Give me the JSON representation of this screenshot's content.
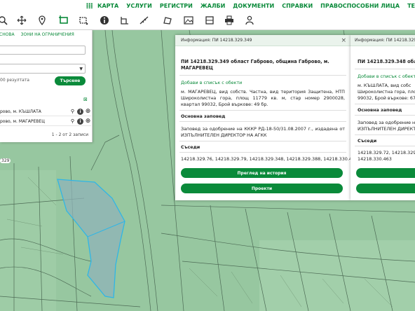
{
  "topnav": {
    "items": [
      "КАРТА",
      "УСЛУГИ",
      "РЕГИСТРИ",
      "ЖАЛБИ",
      "ДОКУМЕНТИ",
      "СПРАВКИ",
      "ПРАВОСПОСОБНИ ЛИЦА",
      "ТЕ"
    ]
  },
  "toolbar": {
    "icons": [
      "zoom-icon",
      "pan-icon",
      "location-pin-icon",
      "select-rectangle-icon",
      "select-polygon-icon",
      "info-icon",
      "measure-angle-icon",
      "measure-distance-icon",
      "area-icon",
      "image-icon",
      "layers-icon",
      "print-icon",
      "user-icon"
    ]
  },
  "left_panel": {
    "tab_a": "СНОВА",
    "tab_b": "ЗОНИ НА ОГРАНИЧЕНИЯ",
    "results": "00 резултата",
    "search_button": "Търсене",
    "rows": [
      "рово, м. КЪШЛАТА",
      "рово, м. МАГАРЕВЕЦ"
    ],
    "pager": "1 - 2 от 2 записи"
  },
  "popup1": {
    "header": "Информация: ПИ 14218.329.349",
    "title": "ПИ 14218.329.349 област Габрово, община Габрово, м. МАГАРЕВЕЦ",
    "add_link": "Добави в списък с обекти",
    "description": "м. МАГАРЕВЕЦ, вид собств. Частна, вид територия Защитена, НТП Широколистна гора, площ 11779 кв. м, стар номер 2900028, квартал 99032, Брой въркове: 49 бр.",
    "order_heading": "Основна заповед",
    "order_text": "Заповед за одобрение на КККР РД-18-50/31.08.2007 г., издадена от ИЗПЪЛНИТЕЛЕН ДИРЕКТОР НА АГКК",
    "neighbors_heading": "Съседи",
    "neighbors_text": "14218.329.76, 14218.329.79, 14218.329.348, 14218.329.388, 14218.330.463",
    "history_button": "Преглед на история",
    "projects_button": "Проекти"
  },
  "popup2": {
    "header": "Информация: ПИ 14218.329.34",
    "title": "ПИ 14218.329.348 облас",
    "add_link": "Добави в списък с обекти",
    "description_l1": "м. КЪШЛАТА, вид собс",
    "description_l2": "Широколистна гора, площ",
    "description_l3": "99032, Брой въркове: 67 б",
    "order_heading": "Основна заповед",
    "order_l1": "Заповед за одобрение н",
    "order_l2": "ИЗПЪЛНИТЕЛЕН ДИРЕКТО",
    "neighbors_heading": "Съседи",
    "neighbors_l1": "14218.329.72, 14218.329.7",
    "neighbors_l2": "14218.330.463"
  },
  "map_labels": {
    "label_329": "329"
  },
  "colors": {
    "brand_green": "#0a8a3a",
    "map_green": "#97c7a0",
    "parcel_fill": "#8fb3b8",
    "parcel_outline": "#2fb6e6"
  }
}
